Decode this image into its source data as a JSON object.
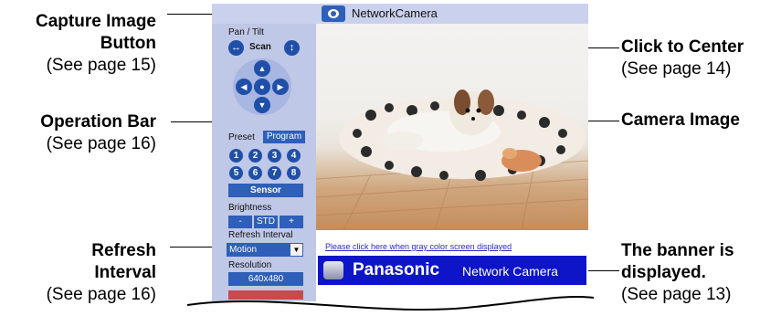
{
  "callouts": {
    "capture_title1": "Capture Image",
    "capture_title2": "Button",
    "capture_ref": "(See page 15)",
    "operation_title": "Operation Bar",
    "operation_ref": "(See page 16)",
    "refresh_title1": "Refresh",
    "refresh_title2": "Interval",
    "refresh_ref": "(See page 16)",
    "center_title": "Click to Center",
    "center_ref": "(See page 14)",
    "camimage_title": "Camera Image",
    "banner_title1": "The banner is",
    "banner_title2": "displayed.",
    "banner_ref": "(See page 13)"
  },
  "camera": {
    "title": "NetworkCamera"
  },
  "panel": {
    "pan_tilt": "Pan / Tilt",
    "scan": "Scan",
    "preset": "Preset",
    "program": "Program",
    "presets": [
      "1",
      "2",
      "3",
      "4",
      "5",
      "6",
      "7",
      "8"
    ],
    "sensor": "Sensor",
    "brightness": "Brightness",
    "bright_minus": "-",
    "bright_std": "STD",
    "bright_plus": "+",
    "refresh_label": "Refresh Interval",
    "refresh_value": "Motion",
    "resolution_label": "Resolution",
    "resolution_value": "640x480"
  },
  "link_text": "Please click here when gray color screen displayed",
  "banner": {
    "brand": "Panasonic",
    "product": "Network Camera"
  }
}
